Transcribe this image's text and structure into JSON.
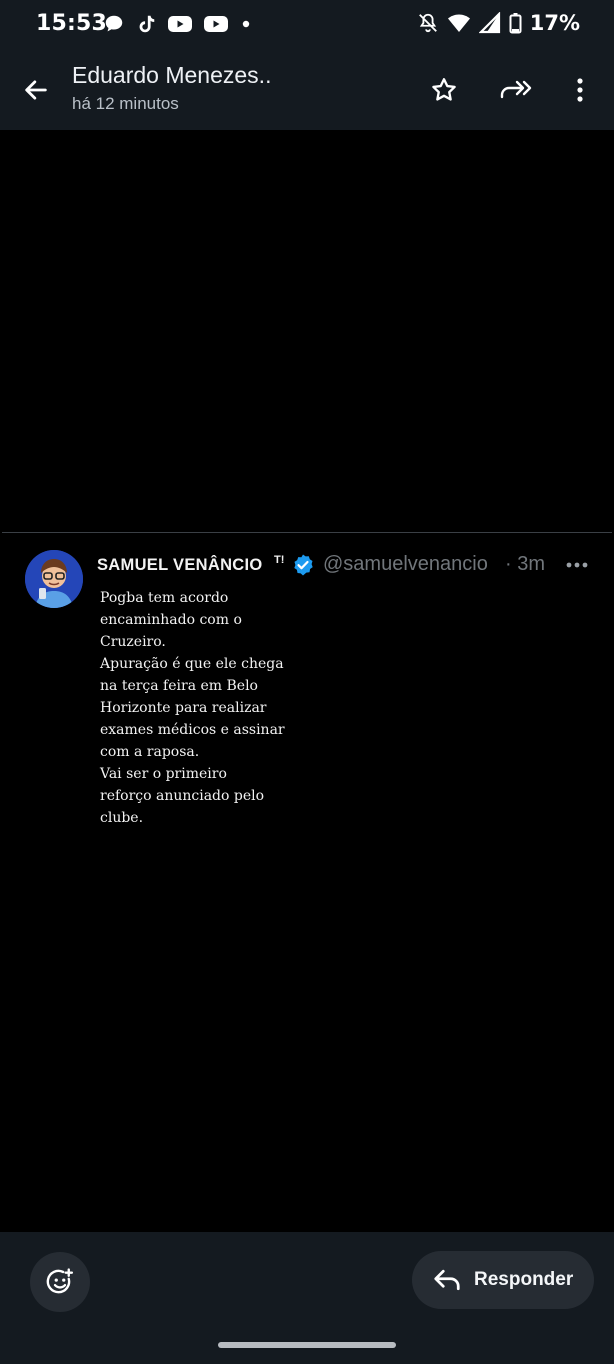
{
  "status_bar": {
    "time": "15:53",
    "battery": "17%",
    "icons_left": [
      "chat-bubble-icon",
      "tiktok-icon",
      "youtube-icon",
      "youtube-icon",
      "dot-icon"
    ],
    "icons_right": [
      "mute-icon",
      "wifi-icon",
      "signal-icon",
      "battery-icon"
    ]
  },
  "header": {
    "title": "Eduardo Menezes..",
    "subtitle": "há 12 minutos",
    "actions": [
      "star-icon",
      "forward-icon",
      "more-vert-icon"
    ]
  },
  "post": {
    "author": "SAMUEL VENÂNCIO",
    "author_suffix": "T!",
    "handle": "@samuelvenancio",
    "time": "· 3m",
    "text": "Pogba tem acordo\nencaminhado com o\nCruzeiro.\nApuração é que ele chega\nna terça feira em Belo\nHorizonte para realizar\nexames médicos e assinar\ncom a raposa.\n Vai ser o primeiro\nreforço anunciado pelo\nclube."
  },
  "bottom": {
    "reply_label": "Responder"
  },
  "colors": {
    "bar_bg": "#141a20",
    "muted_text": "#71767b",
    "verified_blue": "#1d9bf0",
    "button_bg": "#262c33"
  }
}
